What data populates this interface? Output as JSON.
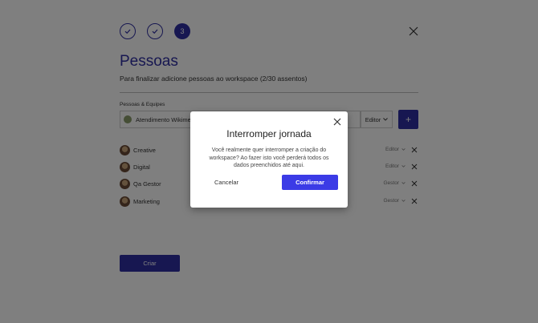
{
  "stepper": {
    "current_step": "3"
  },
  "header": {
    "title": "Pessoas",
    "subtitle": "Para finalizar adicione pessoas ao workspace (2/30 assentos)"
  },
  "form": {
    "section_label": "Pessoas & Equipes",
    "selected_team": "Atendimento Wikimee",
    "role_value": "Editor",
    "add_label": "+"
  },
  "members": [
    {
      "name": "Creative",
      "role": "Editor"
    },
    {
      "name": "Digital",
      "role": "Editor"
    },
    {
      "name": "Qa Gestor",
      "role": "Gestor"
    },
    {
      "name": "Marketing",
      "role": "Gestor"
    }
  ],
  "footer": {
    "create_label": "Criar"
  },
  "modal": {
    "title": "Interromper jornada",
    "body": "Você realmente quer interromper a criação do workspace? Ao fazer isto você perderá todos os dados preenchidos até aqui.",
    "cancel_label": "Cancelar",
    "confirm_label": "Confirmar"
  },
  "colors": {
    "primary": "#2f2fa2",
    "confirm": "#3b3be6",
    "overlay": "rgba(0,0,0,0.5)"
  }
}
